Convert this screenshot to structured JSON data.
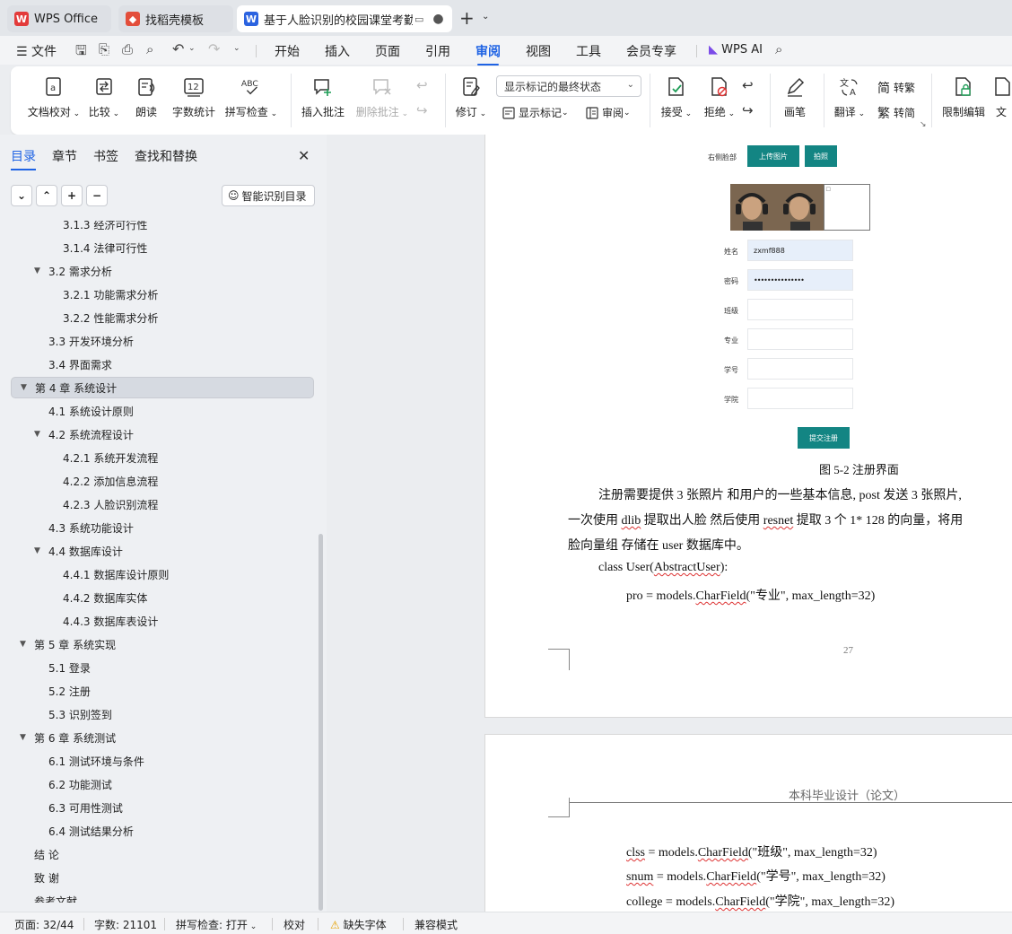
{
  "tabs": [
    {
      "label": "WPS Office"
    },
    {
      "label": "找稻壳模板"
    },
    {
      "label": "基于人脸识别的校园课堂考勤"
    }
  ],
  "menu": {
    "file": "文件",
    "items": [
      "开始",
      "插入",
      "页面",
      "引用",
      "审阅",
      "视图",
      "工具",
      "会员专享"
    ],
    "active": "审阅",
    "wps_ai": "WPS AI"
  },
  "ribbon": {
    "doc_proof": "文档校对",
    "compare": "比较",
    "read_aloud": "朗读",
    "word_count": "字数统计",
    "spell_check": "拼写检查",
    "insert_comment": "插入批注",
    "delete_comment": "删除批注",
    "revise": "修订",
    "display_select": "显示标记的最终状态",
    "show_markup": "显示标记",
    "review": "审阅",
    "accept": "接受",
    "reject": "拒绝",
    "pen": "画笔",
    "translate": "翻译",
    "to_traditional": "转繁",
    "to_simplified": "转简",
    "restrict_edit": "限制编辑",
    "doc_rights": "文"
  },
  "nav": {
    "tabs": [
      "目录",
      "章节",
      "书签",
      "查找和替换"
    ],
    "smart_toc": "智能识别目录",
    "toc": [
      {
        "label": "3.1.3  经济可行性",
        "level": 3
      },
      {
        "label": "3.1.4  法律可行性",
        "level": 3
      },
      {
        "label": "3.2 需求分析",
        "level": 2,
        "expanded": true
      },
      {
        "label": "3.2.1  功能需求分析",
        "level": 3
      },
      {
        "label": "3.2.2  性能需求分析",
        "level": 3
      },
      {
        "label": "3.3 开发环境分析",
        "level": 2
      },
      {
        "label": "3.4 界面需求",
        "level": 2
      },
      {
        "label": "第 4 章  系统设计",
        "level": 1,
        "expanded": true,
        "selected": true
      },
      {
        "label": "4.1 系统设计原则",
        "level": 2
      },
      {
        "label": "4.2 系统流程设计",
        "level": 2,
        "expanded": true
      },
      {
        "label": "4.2.1 系统开发流程",
        "level": 3
      },
      {
        "label": "4.2.2  添加信息流程",
        "level": 3
      },
      {
        "label": "4.2.3  人脸识别流程",
        "level": 3
      },
      {
        "label": "4.3  系统功能设计",
        "level": 2
      },
      {
        "label": "4.4  数据库设计",
        "level": 2,
        "expanded": true
      },
      {
        "label": "4.4.1  数据库设计原则",
        "level": 3
      },
      {
        "label": "4.4.2  数据库实体",
        "level": 3
      },
      {
        "label": "4.4.3  数据库表设计",
        "level": 3
      },
      {
        "label": "第 5 章  系统实现",
        "level": 1,
        "expanded": true
      },
      {
        "label": "5.1  登录",
        "level": 2
      },
      {
        "label": "5.2  注册",
        "level": 2
      },
      {
        "label": "5.3  识别签到",
        "level": 2
      },
      {
        "label": "第 6 章  系统测试",
        "level": 1,
        "expanded": true
      },
      {
        "label": "6.1 测试环境与条件",
        "level": 2
      },
      {
        "label": "6.2 功能测试",
        "level": 2
      },
      {
        "label": "6.3 可用性测试",
        "level": 2
      },
      {
        "label": "6.4 测试结果分析",
        "level": 2
      },
      {
        "label": "结      论",
        "level": 1
      },
      {
        "label": "致      谢",
        "level": 1
      },
      {
        "label": "参考文献",
        "level": 1
      }
    ]
  },
  "doc": {
    "form": {
      "right_face_label": "右侧脸部",
      "upload_btn": "上传图片",
      "capture_btn": "拍照",
      "name_label": "姓名",
      "name_value": "zxmf888",
      "password_label": "密码",
      "password_value": "•••••••••••••••",
      "class_label": "班级",
      "major_label": "专业",
      "student_id_label": "学号",
      "college_label": "学院",
      "submit_btn": "提交注册"
    },
    "caption": "图 5-2 注册界面",
    "para": [
      "注册需要提供 3 张照片 和用户的一些基本信息, post 发送 3 张照片,",
      "一次使用",
      "dlib",
      "提取出人脸 然后使用",
      "resnet",
      "提取 3 个 1* 128 的向量，将用",
      "脸向量组 存储在 user 数据库中。"
    ],
    "code1": [
      "class User(",
      "AbstractUser",
      "):"
    ],
    "code2": [
      "pro = models.",
      "CharField",
      "(\"专业\", max_length=32)"
    ],
    "page_number": "27",
    "header2": "本科毕业设计（论文）",
    "code3": [
      "clss",
      " = models.",
      "CharField",
      "(\"班级\", max_length=32)"
    ],
    "code4": [
      "snum",
      " = models.",
      "CharField",
      "(\"学号\", max_length=32)"
    ],
    "code5": [
      "college = models.",
      "CharField",
      "(\"学院\", max_length=32)"
    ]
  },
  "status": {
    "page": "页面: 32/44",
    "words": "字数: 21101",
    "spell": "拼写检查: 打开",
    "proof": "校对",
    "missing_font": "缺失字体",
    "compat": "兼容模式"
  },
  "colors": {
    "accent": "#1f63e4",
    "teal": "#138583",
    "wps_red": "#e33b3b"
  }
}
